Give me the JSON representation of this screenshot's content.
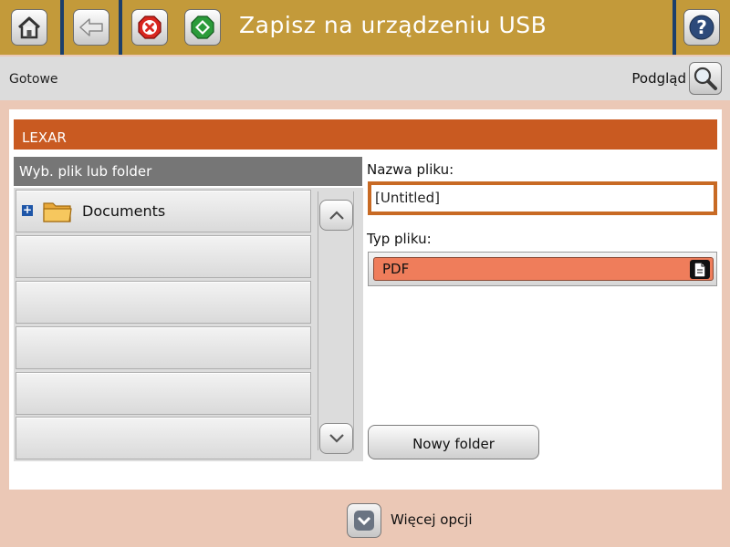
{
  "header": {
    "title": "Zapisz na urządzeniu USB",
    "buttons": {
      "home": "home-icon",
      "back": "back-arrow-icon",
      "stop": "stop-icon",
      "start": "start-icon",
      "help": "help-icon"
    }
  },
  "status": {
    "text": "Gotowe",
    "preview_label": "Podgląd"
  },
  "device": {
    "name": "LEXAR"
  },
  "file_list": {
    "header": "Wyb. plik lub folder",
    "items": [
      {
        "label": "Documents",
        "type": "folder"
      },
      {
        "label": ""
      },
      {
        "label": ""
      },
      {
        "label": ""
      },
      {
        "label": ""
      },
      {
        "label": ""
      }
    ]
  },
  "filename": {
    "label": "Nazwa pliku:",
    "value": "[Untitled]"
  },
  "filetype": {
    "label": "Typ pliku:",
    "value": "PDF"
  },
  "new_folder_button": "Nowy folder",
  "more_options": "Więcej opcji",
  "colors": {
    "accent_gold": "#c39a3a",
    "header_navy": "#1b3f6b",
    "device_bar": "#c95a21",
    "filetype_fill": "#ef7d5b",
    "background": "#ebc8b6"
  }
}
